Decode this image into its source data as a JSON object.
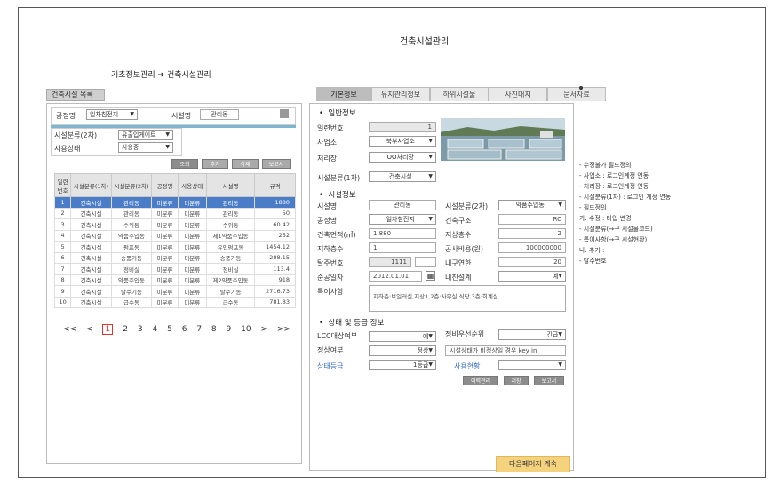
{
  "page_title": "건축시설관리",
  "breadcrumb": "기초정보관리 ➔ 건축시설관리",
  "left_tab": "건축시설 목록",
  "filters": {
    "process_label": "공정명",
    "process_value": "일차침전지",
    "facility_label": "시설명",
    "facility_value": "관리동",
    "class2_label": "시설분류(2차)",
    "class2_value": "유출입게이트",
    "status_label": "사용상태",
    "status_value": "사용중"
  },
  "list_buttons": [
    "조회",
    "추가",
    "삭제",
    "보고서"
  ],
  "table": {
    "headers": [
      "일련번호",
      "시설분류(1차)",
      "시설분류(2차)",
      "공정명",
      "사용상태",
      "시설명",
      "규격"
    ],
    "rows": [
      [
        "1",
        "건축시설",
        "관리동",
        "미분류",
        "미분류",
        "관리동",
        "1880"
      ],
      [
        "2",
        "건축시설",
        "관리동",
        "미분류",
        "미분류",
        "관리동",
        "50"
      ],
      [
        "3",
        "건축시설",
        "수위동",
        "미분류",
        "미분류",
        "수위동",
        "60.42"
      ],
      [
        "4",
        "건축시설",
        "약품주입동",
        "미분류",
        "미분류",
        "제1약품주입동",
        "252"
      ],
      [
        "5",
        "건축시설",
        "펌프동",
        "미분류",
        "미분류",
        "유입펌프동",
        "1454.12"
      ],
      [
        "6",
        "건축시설",
        "송풍기동",
        "미분류",
        "미분류",
        "송풍기동",
        "288.15"
      ],
      [
        "7",
        "건축시설",
        "정비실",
        "미분류",
        "미분류",
        "정비실",
        "113.4"
      ],
      [
        "8",
        "건축시설",
        "약품주입동",
        "미분류",
        "미분류",
        "제2약품주입동",
        "918"
      ],
      [
        "9",
        "건축시설",
        "탈수기동",
        "미분류",
        "미분류",
        "탈수기동",
        "2716.73"
      ],
      [
        "10",
        "건축시설",
        "급수동",
        "미분류",
        "미분류",
        "급수동",
        "781.83"
      ]
    ]
  },
  "pager": [
    "<<",
    "<",
    "1",
    "2",
    "3",
    "4",
    "5",
    "6",
    "7",
    "8",
    "9",
    "10",
    ">",
    ">>"
  ],
  "tabs": [
    "기본정보",
    "유지관리정보",
    "하위시설물",
    "사진대지",
    "문서자료"
  ],
  "general": {
    "title": "일반정보",
    "serial_label": "일련번호",
    "serial_value": "1",
    "office_label": "사업소",
    "office_value": "북부사업소",
    "plant_label": "처리장",
    "plant_value": "OO처리장",
    "class1_label": "시설분류(1차)",
    "class1_value": "건축시설"
  },
  "facility": {
    "title": "시설정보",
    "name_label": "시설명",
    "name_value": "관리동",
    "class2_label": "시설분류(2차)",
    "class2_value": "약품주입동",
    "process_label": "공정명",
    "process_value": "일차침전지",
    "structure_label": "건축구조",
    "structure_value": "RC",
    "area_label": "건축면적(㎡)",
    "area_value": "1,880",
    "above_label": "지상층수",
    "above_value": "2",
    "below_label": "지하층수",
    "below_value": "1",
    "cost_label": "공사비용(원)",
    "cost_value": "100000000",
    "asset_label": "탈주번호",
    "asset_value": "1111",
    "years_label": "내구연한",
    "years_value": "20",
    "done_label": "준공일자",
    "done_value": "2012.01.01",
    "quake_label": "내진설계",
    "quake_value": "예",
    "special_label": "특이사항",
    "special_value": "지하층:보일러실,지상1,2층:사무실,식당,3층:회계실"
  },
  "status": {
    "title": "상태 및 등급 정보",
    "lcc_label": "LCC대상여부",
    "lcc_value": "예",
    "priority_label": "정비우선순위",
    "priority_value": "긴급",
    "normal_label": "정상여부",
    "normal_value": "정상",
    "normal_note": "시설상태가 비정상일 경우 key in",
    "grade_label": "상태등급",
    "grade_value": "1등급",
    "history_label": "사용현황"
  },
  "status_buttons": [
    "이력관리",
    "저장",
    "보고서"
  ],
  "notes": [
    "- 수정불가 필드정의",
    "  - 사업소 : 로그인계정 연동",
    "  - 처리장 : 로그인계정 연동",
    "  - 시설분류(1차) : 로그인 계정 연동",
    "- 필드정의",
    "  가. 수정 : 타입 변경",
    "    - 시설분류(→구 시설물코드)",
    "    - 특이사항(→구 시설현황)",
    "  나. 추가 :",
    "    - 탈주번호"
  ],
  "next_button": "다음페이지 계속"
}
